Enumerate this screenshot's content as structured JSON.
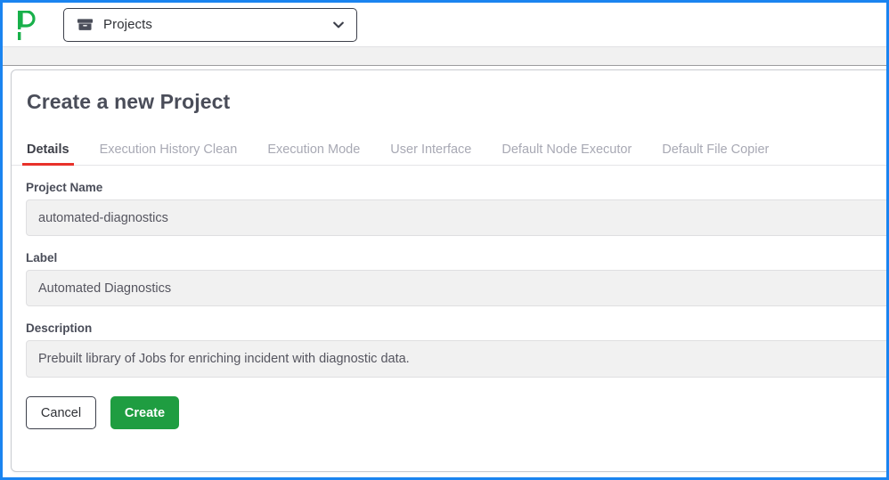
{
  "navbar": {
    "logo_icon": "rundeck-p-logo-icon",
    "project_selector": {
      "icon": "box-archive-icon",
      "label": "Projects",
      "chevron_icon": "chevron-down-icon"
    }
  },
  "card": {
    "title": "Create a new Project",
    "tabs": [
      {
        "label": "Details",
        "active": true
      },
      {
        "label": "Execution History Clean",
        "active": false
      },
      {
        "label": "Execution Mode",
        "active": false
      },
      {
        "label": "User Interface",
        "active": false
      },
      {
        "label": "Default Node Executor",
        "active": false
      },
      {
        "label": "Default File Copier",
        "active": false
      }
    ],
    "fields": [
      {
        "label": "Project Name",
        "value": "automated-diagnostics",
        "placeholder": ""
      },
      {
        "label": "Label",
        "value": "Automated Diagnostics",
        "placeholder": ""
      },
      {
        "label": "Description",
        "value": "Prebuilt library of Jobs for enriching incident with diagnostic data.",
        "placeholder": ""
      }
    ],
    "buttons": {
      "cancel_label": "Cancel",
      "create_label": "Create"
    }
  },
  "colors": {
    "brand_green": "#18b04a",
    "create_button_green": "#1f9d41",
    "active_tab_underline_red": "#e8312a",
    "viewport_outline_blue": "#1a84f0",
    "input_background": "#f1f1f1",
    "text_dark": "#4a4d59",
    "text_muted": "#a8a9b4"
  }
}
